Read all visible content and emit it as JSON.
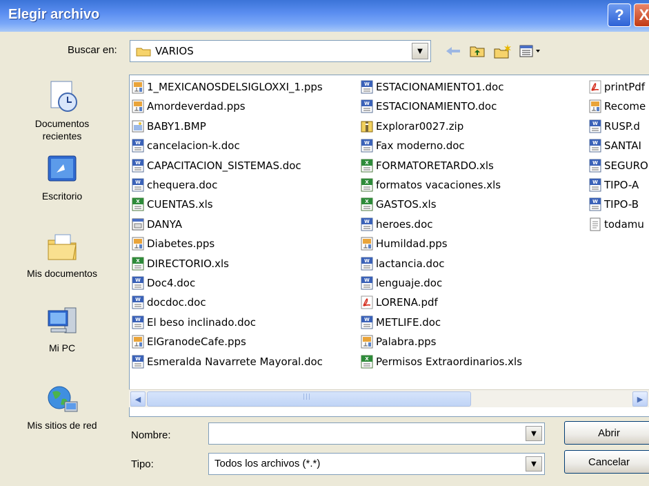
{
  "window": {
    "title": "Elegir archivo",
    "help_glyph": "?",
    "close_glyph": "X"
  },
  "lookin": {
    "label": "Buscar en:",
    "value": "VARIOS",
    "icon": "folder-icon"
  },
  "toolbar": {
    "icons": [
      "back-arrow-icon",
      "up-folder-icon",
      "new-folder-icon",
      "views-menu-icon"
    ]
  },
  "places": [
    {
      "label": "Documentos recientes",
      "icon": "recent-documents-icon"
    },
    {
      "label": "Escritorio",
      "icon": "desktop-icon"
    },
    {
      "label": "Mis documentos",
      "icon": "my-documents-icon"
    },
    {
      "label": "Mi PC",
      "icon": "my-computer-icon"
    },
    {
      "label": "Mis sitios de red",
      "icon": "network-places-icon"
    }
  ],
  "files": {
    "column1": [
      {
        "name": "1_MEXICANOSDELSIGLOXXI_1.pps",
        "type": "pps"
      },
      {
        "name": "Amordeverdad.pps",
        "type": "pps"
      },
      {
        "name": "BABY1.BMP",
        "type": "bmp"
      },
      {
        "name": "cancelacion-k.doc",
        "type": "doc"
      },
      {
        "name": "CAPACITACION_SISTEMAS.doc",
        "type": "doc"
      },
      {
        "name": "chequera.doc",
        "type": "doc"
      },
      {
        "name": "CUENTAS.xls",
        "type": "xls"
      },
      {
        "name": "DANYA",
        "type": "generic"
      },
      {
        "name": "Diabetes.pps",
        "type": "pps"
      },
      {
        "name": "DIRECTORIO.xls",
        "type": "xls"
      },
      {
        "name": "Doc4.doc",
        "type": "doc"
      },
      {
        "name": "docdoc.doc",
        "type": "doc"
      },
      {
        "name": "El beso inclinado.doc",
        "type": "doc"
      },
      {
        "name": "ElGranodeCafe.pps",
        "type": "pps"
      },
      {
        "name": "Esmeralda Navarrete Mayoral.doc",
        "type": "doc"
      }
    ],
    "column2": [
      {
        "name": "ESTACIONAMIENTO1.doc",
        "type": "doc"
      },
      {
        "name": "ESTACIONAMIENTO.doc",
        "type": "doc"
      },
      {
        "name": "Explorar0027.zip",
        "type": "zip"
      },
      {
        "name": "Fax moderno.doc",
        "type": "doc"
      },
      {
        "name": "FORMATORETARDO.xls",
        "type": "xls"
      },
      {
        "name": "formatos vacaciones.xls",
        "type": "xls"
      },
      {
        "name": "GASTOS.xls",
        "type": "xls"
      },
      {
        "name": "heroes.doc",
        "type": "doc"
      },
      {
        "name": "Humildad.pps",
        "type": "pps"
      },
      {
        "name": "lactancia.doc",
        "type": "doc"
      },
      {
        "name": "lenguaje.doc",
        "type": "doc"
      },
      {
        "name": "LORENA.pdf",
        "type": "pdf"
      },
      {
        "name": "METLIFE.doc",
        "type": "doc"
      },
      {
        "name": "Palabra.pps",
        "type": "pps"
      },
      {
        "name": "Permisos Extraordinarios.xls",
        "type": "xls"
      }
    ],
    "column3": [
      {
        "name": "printPdf",
        "type": "pdf"
      },
      {
        "name": "Recome",
        "type": "pps"
      },
      {
        "name": "RUSP.d",
        "type": "doc"
      },
      {
        "name": "SANTAI",
        "type": "doc"
      },
      {
        "name": "SEGURO",
        "type": "doc"
      },
      {
        "name": "TIPO-A",
        "type": "doc"
      },
      {
        "name": "TIPO-B",
        "type": "doc"
      },
      {
        "name": "todamu",
        "type": "txt"
      }
    ]
  },
  "scrollbar": {
    "left_glyph": "◀",
    "right_glyph": "▶"
  },
  "filename": {
    "label": "Nombre:",
    "value": ""
  },
  "filetype": {
    "label": "Tipo:",
    "value": "Todos los archivos (*.*)"
  },
  "buttons": {
    "open": "Abrir",
    "cancel": "Cancelar"
  },
  "colors": {
    "titlebar": "#3B74D8",
    "dialog_bg": "#ECE9D8",
    "field_border": "#7F9DB9"
  }
}
